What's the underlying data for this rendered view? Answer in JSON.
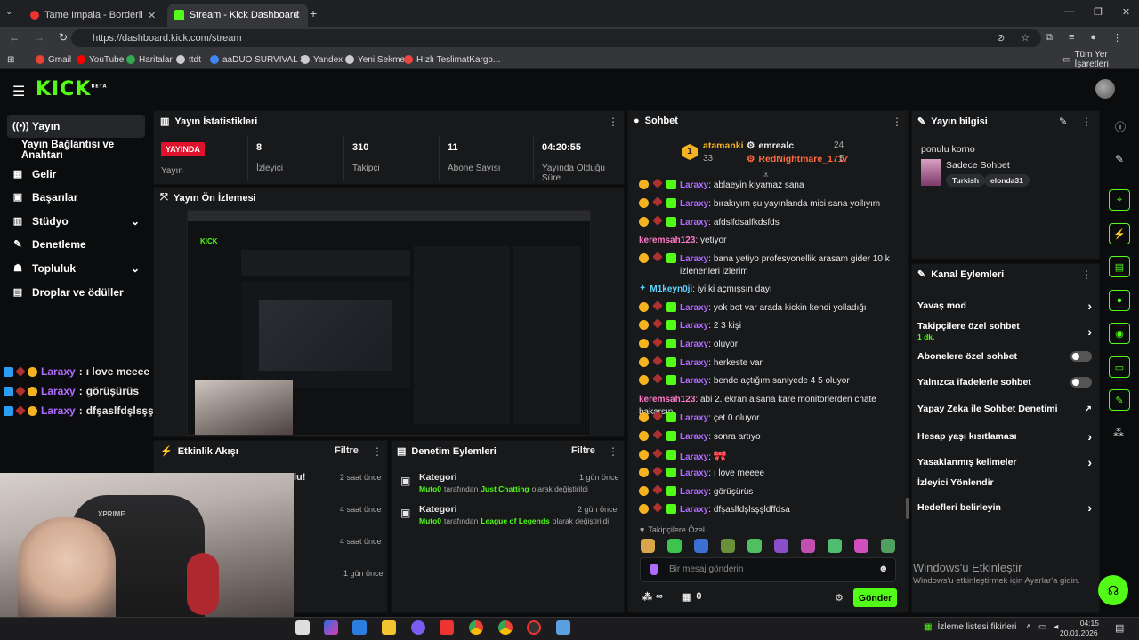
{
  "browser": {
    "tabs": [
      {
        "title": "Tame Impala - Borderline (L"
      },
      {
        "title": "Stream - Kick Dashboard"
      }
    ],
    "url": "https://dashboard.kick.com/stream",
    "bookmarks": [
      "Gmail",
      "YouTube",
      "Haritalar",
      "ttdt",
      "aaDUO SURVIVAL 3...",
      "Yandex",
      "Yeni Sekme",
      "Hızlı TeslimatKargo..."
    ],
    "all_bookmarks": "Tüm Yer İşaretleri"
  },
  "kick": {
    "logo": "KICK",
    "beta": "BETA"
  },
  "sidebar": {
    "items": [
      {
        "label": "Yayın",
        "icon": "broadcast-icon"
      },
      {
        "label": "Yayın Bağlantısı ve Anahtarı",
        "icon": ""
      },
      {
        "label": "Gelir",
        "icon": "dollar-icon"
      },
      {
        "label": "Başarılar",
        "icon": "trophy-icon"
      },
      {
        "label": "Stüdyo",
        "icon": "studio-icon"
      },
      {
        "label": "Denetleme",
        "icon": "wrench-icon"
      },
      {
        "label": "Topluluk",
        "icon": "people-icon"
      },
      {
        "label": "Droplar ve ödüller",
        "icon": "gift-icon"
      }
    ]
  },
  "overlay_chat": [
    {
      "user": "Laraxy",
      "text": "ı love meeee"
    },
    {
      "user": "Laraxy",
      "text": "görüşürüs"
    },
    {
      "user": "Laraxy",
      "text": "dfşaslfdşlsşşldffdsa"
    }
  ],
  "stats": {
    "title": "Yayın İstatistikleri",
    "live_badge": "YAYINDA",
    "live_label": "Yayın",
    "viewers": "8",
    "viewers_label": "İzleyici",
    "followers": "310",
    "followers_label": "Takipçi",
    "subs": "11",
    "subs_label": "Abone Sayısı",
    "duration": "04:20:55",
    "duration_label": "Yayında Olduğu Süre"
  },
  "preview": {
    "title": "Yayın Ön İzlemesi"
  },
  "activity": {
    "title": "Etkinlik Akışı",
    "filter": "Filtre",
    "partial_text": "lu!",
    "times": [
      "2 saat önce",
      "4 saat önce",
      "4 saat önce",
      "1 gün önce"
    ]
  },
  "moderation": {
    "title": "Denetim Eylemleri",
    "filter": "Filtre",
    "items": [
      {
        "head": "Kategori",
        "user": "Muto0",
        "mid": "tarafından",
        "cat": "Just Chatting",
        "tail": "olarak değiştirildi",
        "time": "1 gün önce"
      },
      {
        "head": "Kategori",
        "user": "Muto0",
        "mid": "tarafından",
        "cat": "League of Legends",
        "tail": "olarak değiştirildi",
        "time": "2 gün önce"
      }
    ]
  },
  "chat": {
    "title": "Sohbet",
    "leaderboard": [
      {
        "rank": "1",
        "name": "atamanki",
        "count": "33"
      },
      {
        "name": "emrealc",
        "count": "24"
      },
      {
        "name": "RedNightmare_1717",
        "count": "5"
      }
    ],
    "messages": [
      {
        "user": "Laraxy",
        "text": "ablaeyin kıyamaz sana",
        "badges": true,
        "color": "#b06bff"
      },
      {
        "user": "Laraxy",
        "text": "bırakıyım şu yayınlanda mici sana yollıyım",
        "badges": true,
        "color": "#b06bff"
      },
      {
        "user": "Laraxy",
        "text": "afdslfdsalfkdsfds",
        "badges": true,
        "color": "#b06bff"
      },
      {
        "user": "keremsah123",
        "text": "yetiyor",
        "badges": false,
        "color": "#ff79c6"
      },
      {
        "user": "Laraxy",
        "text": "bana yetiyo profesyonellik arasam gider 10 k izlenenleri izlerim",
        "badges": true,
        "color": "#b06bff"
      },
      {
        "user": "M1keyn0ji",
        "text": "iyi ki açmışsın dayı",
        "badges": false,
        "color": "#5fd3ff"
      },
      {
        "user": "Laraxy",
        "text": "yok bot var arada kickin kendi yolladığı",
        "badges": true,
        "color": "#b06bff"
      },
      {
        "user": "Laraxy",
        "text": "2 3 kişi",
        "badges": true,
        "color": "#b06bff"
      },
      {
        "user": "Laraxy",
        "text": "oluyor",
        "badges": true,
        "color": "#b06bff"
      },
      {
        "user": "Laraxy",
        "text": "herkeste var",
        "badges": true,
        "color": "#b06bff"
      },
      {
        "user": "Laraxy",
        "text": "bende açtığım saniyede 4 5 oluyor",
        "badges": true,
        "color": "#b06bff"
      },
      {
        "user": "keremsah123",
        "text": "abi 2. ekran alsana kare monitörlerden chate bakarsın",
        "badges": false,
        "color": "#ff79c6"
      },
      {
        "user": "Laraxy",
        "text": "çet 0 oluyor",
        "badges": true,
        "color": "#b06bff"
      },
      {
        "user": "Laraxy",
        "text": "sonra artıyo",
        "badges": true,
        "color": "#b06bff"
      },
      {
        "user": "Laraxy",
        "text": "",
        "badges": true,
        "color": "#b06bff"
      },
      {
        "user": "Laraxy",
        "text": "ı love meeee",
        "badges": true,
        "color": "#b06bff"
      },
      {
        "user": "Laraxy",
        "text": "görüşürüs",
        "badges": true,
        "color": "#b06bff"
      },
      {
        "user": "Laraxy",
        "text": "dfşaslfdşlsşşldffdsa",
        "badges": true,
        "color": "#b06bff"
      }
    ],
    "followers_only": "Takipçilere Özel",
    "placeholder": "Bir mesaj gönderin",
    "infinity": "∞",
    "gift_count": "0",
    "send": "Gönder"
  },
  "stream_info": {
    "title": "Yayın bilgisi",
    "stream_title": "ponulu korno",
    "category": "Sadece Sohbet",
    "tags": [
      "Turkish",
      "elonda31"
    ]
  },
  "channel_actions": {
    "title": "Kanal Eylemleri",
    "items": [
      {
        "label": "Yavaş mod",
        "type": "chevron"
      },
      {
        "label": "Takipçilere özel sohbet",
        "sub": "1 dk.",
        "type": "chevron"
      },
      {
        "label": "Abonelere özel sohbet",
        "type": "toggle"
      },
      {
        "label": "Yalnızca ifadelerle sohbet",
        "type": "toggle"
      },
      {
        "label": "Yapay Zeka ile Sohbet Denetimi",
        "type": "external"
      },
      {
        "label": "Hesap yaşı kısıtlaması",
        "type": "chevron"
      },
      {
        "label": "Yasaklanmış kelimeler",
        "type": "chevron"
      },
      {
        "label": "İzleyici Yönlendir",
        "type": "none"
      },
      {
        "label": "Hedefleri belirleyin",
        "type": "chevron"
      }
    ]
  },
  "windows": {
    "activate": "Windows'u Etkinleştir",
    "activate_sub": "Windows'u etkinleştirmek için Ayarlar'a gidin.",
    "watchlist": "İzleme listesi fikirleri",
    "time": "04:15",
    "date": "20.01.2026"
  },
  "colors": {
    "accent": "#53fc18",
    "live": "#e0112b",
    "panel": "#18191b"
  }
}
